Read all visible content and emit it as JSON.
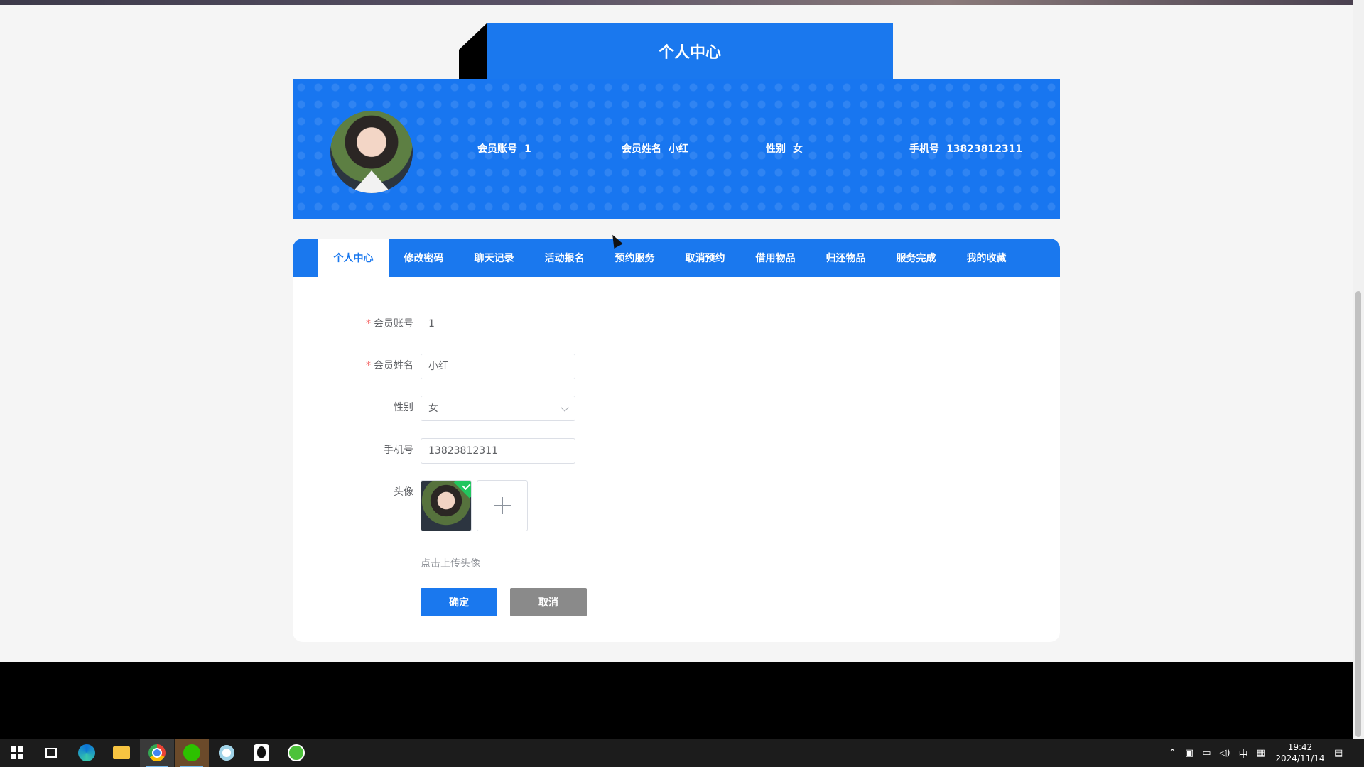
{
  "page": {
    "title": "个人中心"
  },
  "banner": {
    "account_label": "会员账号",
    "account_value": "1",
    "name_label": "会员姓名",
    "name_value": "小红",
    "gender_label": "性别",
    "gender_value": "女",
    "phone_label": "手机号",
    "phone_value": "13823812311"
  },
  "nav": {
    "items": [
      {
        "label": "个人中心",
        "active": true
      },
      {
        "label": "修改密码"
      },
      {
        "label": "聊天记录"
      },
      {
        "label": "活动报名"
      },
      {
        "label": "预约服务"
      },
      {
        "label": "取消预约"
      },
      {
        "label": "借用物品"
      },
      {
        "label": "归还物品"
      },
      {
        "label": "服务完成"
      },
      {
        "label": "我的收藏"
      }
    ]
  },
  "form": {
    "account_label": "会员账号",
    "account_value": "1",
    "name_label": "会员姓名",
    "name_value": "小红",
    "gender_label": "性别",
    "gender_value": "女",
    "phone_label": "手机号",
    "phone_value": "13823812311",
    "avatar_label": "头像",
    "upload_hint": "点击上传头像",
    "confirm_label": "确定",
    "cancel_label": "取消"
  },
  "taskbar": {
    "ime": "中",
    "time": "19:42",
    "date": "2024/11/14"
  },
  "colors": {
    "primary": "#1a78ee",
    "cancel": "#8a8a8a",
    "required": "#f56c6c"
  }
}
